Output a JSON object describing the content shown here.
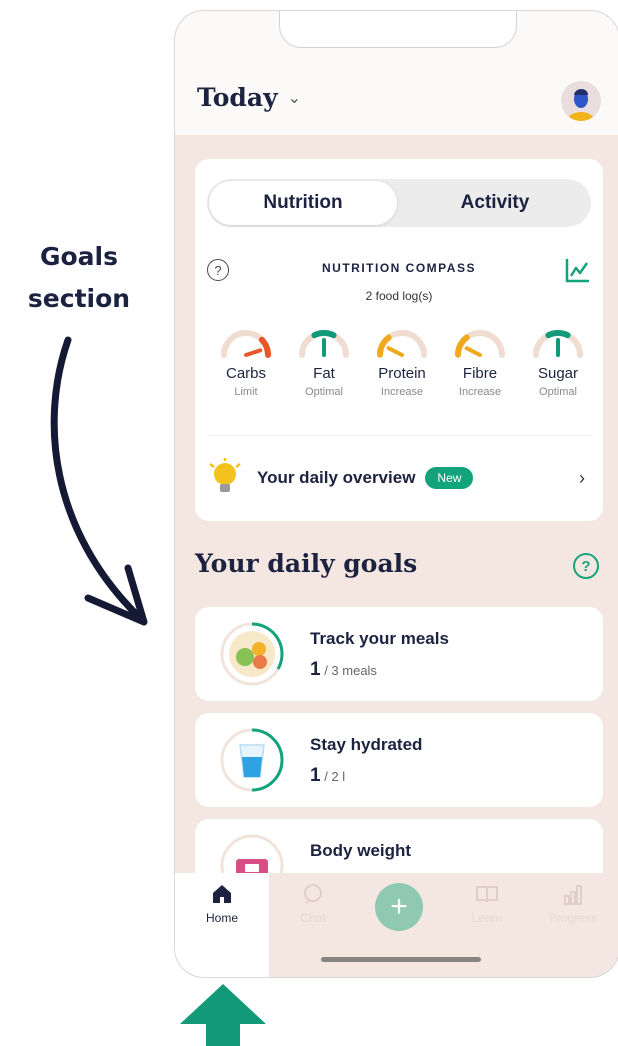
{
  "annotation": {
    "label": "Goals section"
  },
  "header": {
    "title": "Today"
  },
  "nutrition_card": {
    "tabs": [
      {
        "label": "Nutrition"
      },
      {
        "label": "Activity"
      }
    ],
    "compass_title": "NUTRITION COMPASS",
    "compass_subtitle": "2 food log(s)",
    "gauges": [
      {
        "name": "Carbs",
        "status": "Limit",
        "color": "#e8562a",
        "level": 0.9
      },
      {
        "name": "Fat",
        "status": "Optimal",
        "color": "#11997a",
        "level": 0.5
      },
      {
        "name": "Protein",
        "status": "Increase",
        "color": "#f0a81c",
        "level": 0.15
      },
      {
        "name": "Fibre",
        "status": "Increase",
        "color": "#f0a81c",
        "level": 0.15
      },
      {
        "name": "Sugar",
        "status": "Optimal",
        "color": "#11997a",
        "level": 0.5
      }
    ],
    "overview_label": "Your daily overview",
    "overview_badge": "New"
  },
  "goals": {
    "heading": "Your daily goals",
    "items": [
      {
        "title": "Track your meals",
        "current": "1",
        "target": " / 3 meals",
        "progress": 0.33
      },
      {
        "title": "Stay hydrated",
        "current": "1",
        "target": " / 2 l",
        "progress": 0.5
      },
      {
        "title": "Body weight",
        "current": "",
        "target": ""
      }
    ]
  },
  "tabbar": {
    "items": [
      {
        "label": "Home"
      },
      {
        "label": "Chat"
      },
      {
        "label": "Learn"
      },
      {
        "label": "Progress"
      }
    ]
  },
  "colors": {
    "accent": "#13a37b",
    "background": "#f4e7e1",
    "text": "#1c2340"
  }
}
